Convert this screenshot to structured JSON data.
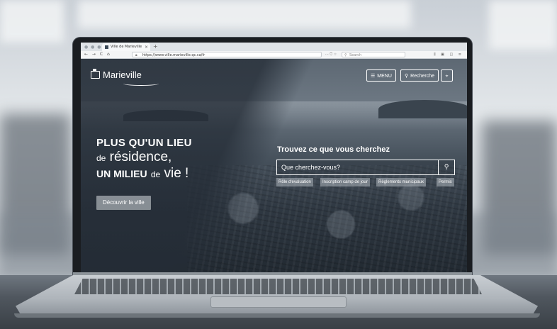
{
  "browser": {
    "tab_title": "Ville de Marieville",
    "tab_close": "×",
    "tab_new": "+",
    "nav_buttons": "← → C ⌂",
    "url": "https://www.ville.marieville.qc.ca/fr",
    "url_actions": "··· ⛉ ☆",
    "search_placeholder": "Search",
    "tool_icons": "⫼ ▣ ◫ ≡"
  },
  "site": {
    "logo_text": "Marieville",
    "menu_label": "MENU",
    "search_label": "Recherche",
    "hero": {
      "line1": "PLUS QU'UN LIEU",
      "line2_small": "de",
      "line2_big": "résidence,",
      "line3_bold": "UN MILIEU",
      "line3_small": "de",
      "line3_big": "vie !",
      "cta": "Découvrir la ville"
    },
    "search": {
      "title": "Trouvez ce que vous cherchez",
      "placeholder": "Que cherchez-vous?",
      "quick_links": [
        "Rôle d'évaluation",
        "Inscription camp de jour",
        "Règlements municipaux",
        "Permis"
      ]
    }
  },
  "icons": {
    "menu": "☰",
    "search": "⚲",
    "location": "⚲"
  }
}
